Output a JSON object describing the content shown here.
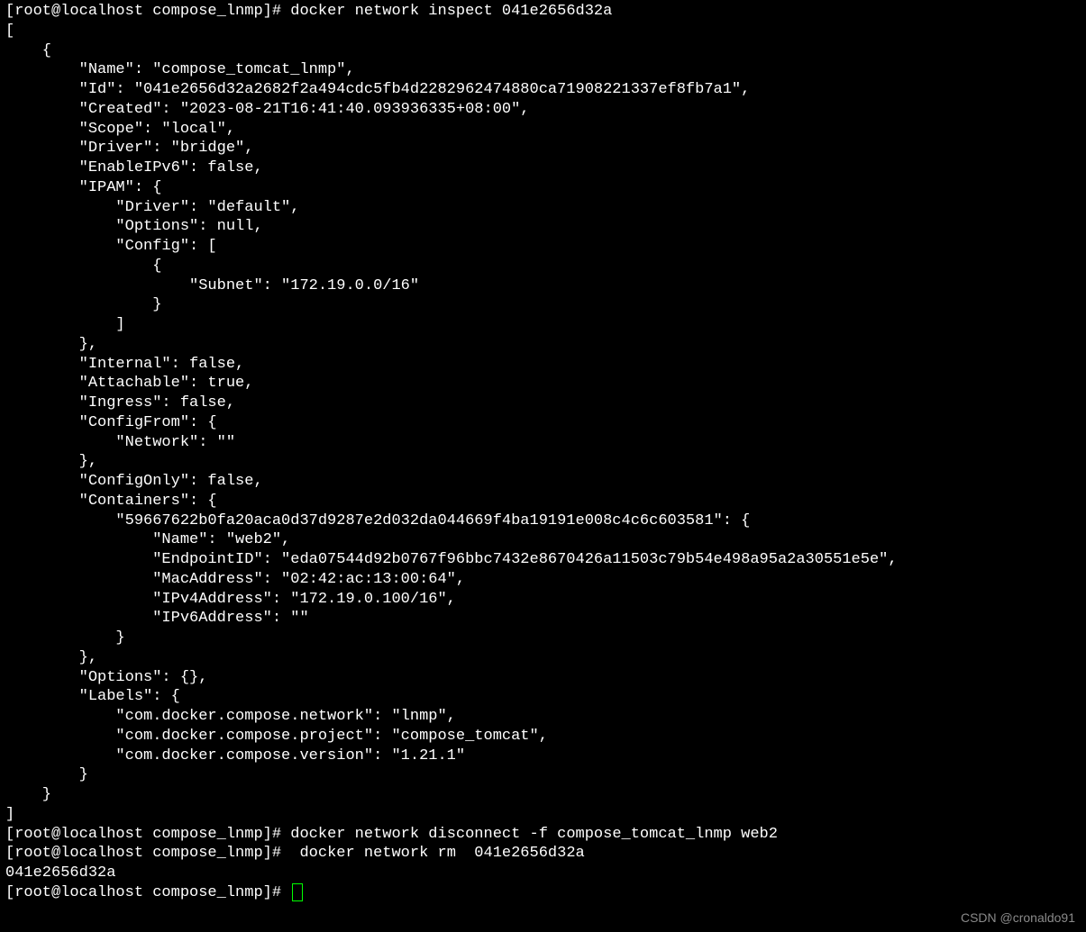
{
  "prompt": "[root@localhost compose_lnmp]# ",
  "cmd1": "docker network inspect 041e2656d32a",
  "json_output": "[\n    {\n        \"Name\": \"compose_tomcat_lnmp\",\n        \"Id\": \"041e2656d32a2682f2a494cdc5fb4d2282962474880ca71908221337ef8fb7a1\",\n        \"Created\": \"2023-08-21T16:41:40.093936335+08:00\",\n        \"Scope\": \"local\",\n        \"Driver\": \"bridge\",\n        \"EnableIPv6\": false,\n        \"IPAM\": {\n            \"Driver\": \"default\",\n            \"Options\": null,\n            \"Config\": [\n                {\n                    \"Subnet\": \"172.19.0.0/16\"\n                }\n            ]\n        },\n        \"Internal\": false,\n        \"Attachable\": true,\n        \"Ingress\": false,\n        \"ConfigFrom\": {\n            \"Network\": \"\"\n        },\n        \"ConfigOnly\": false,\n        \"Containers\": {\n            \"59667622b0fa20aca0d37d9287e2d032da044669f4ba19191e008c4c6c603581\": {\n                \"Name\": \"web2\",\n                \"EndpointID\": \"eda07544d92b0767f96bbc7432e8670426a11503c79b54e498a95a2a30551e5e\",\n                \"MacAddress\": \"02:42:ac:13:00:64\",\n                \"IPv4Address\": \"172.19.0.100/16\",\n                \"IPv6Address\": \"\"\n            }\n        },\n        \"Options\": {},\n        \"Labels\": {\n            \"com.docker.compose.network\": \"lnmp\",\n            \"com.docker.compose.project\": \"compose_tomcat\",\n            \"com.docker.compose.version\": \"1.21.1\"\n        }\n    }\n]",
  "cmd2": "docker network disconnect -f compose_tomcat_lnmp web2",
  "cmd3": " docker network rm  041e2656d32a",
  "out3": "041e2656d32a",
  "watermark": "CSDN @cronaldo91"
}
